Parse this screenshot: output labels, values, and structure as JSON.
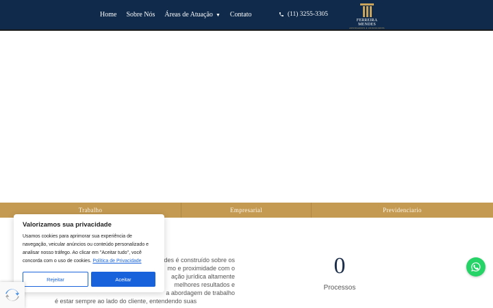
{
  "header": {
    "nav": [
      {
        "label": "Home"
      },
      {
        "label": "Sobre Nós"
      },
      {
        "label": "Áreas de Atuação",
        "has_dropdown": true
      },
      {
        "label": "Contato"
      }
    ],
    "phone": "(11) 3255-3305",
    "logo": {
      "name": "FERREIRA MENDES",
      "tagline": "ADVOGADOS & ASSOCIADOS"
    },
    "background": "#0f2a4a"
  },
  "practice_bar": {
    "tabs": [
      {
        "label": "Trabalho"
      },
      {
        "label": "Empresarial"
      },
      {
        "label": "Previdenciario"
      }
    ],
    "color": "#c49a52"
  },
  "about": {
    "line1": "des é construído sobre os",
    "line2": "mo e proximidade com o",
    "line3": "ação jurídica altamente",
    "line4": "melhores resultados e",
    "line5": "a abordagem de trabalho",
    "line6": "é estar sempre ao lado do cliente, entendendo suas"
  },
  "stats": {
    "number": "0",
    "label": "Processos"
  },
  "cookie": {
    "title": "Valorizamos sua privacidade",
    "text": "Usamos cookies para aprimorar sua experiência de navegação, veicular anúncios ou conteúdo personalizado e analisar nosso tráfego. Ao clicar em \"Aceitar tudo\", você concorda com o uso de cookies.",
    "link": "Política de Privacidade",
    "reject": "Rejeitar",
    "accept": "Aceitar",
    "accent": "#1863dc"
  },
  "icons": {
    "phone": "phone-icon",
    "whatsapp": "whatsapp-icon",
    "recaptcha": "recaptcha-icon"
  }
}
